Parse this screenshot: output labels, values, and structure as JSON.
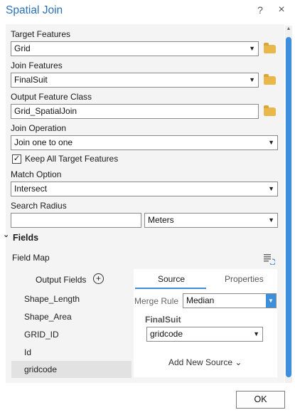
{
  "window": {
    "title": "Spatial Join",
    "help_label": "?",
    "close_label": "×"
  },
  "form": {
    "target_features": {
      "label": "Target Features",
      "value": "Grid"
    },
    "join_features": {
      "label": "Join Features",
      "value": "FinalSuit"
    },
    "output_feature_class": {
      "label": "Output Feature Class",
      "value": "Grid_SpatialJoin"
    },
    "join_operation": {
      "label": "Join Operation",
      "value": "Join one to one"
    },
    "keep_all": {
      "label": "Keep All Target Features",
      "checked": true,
      "check_glyph": "✓"
    },
    "match_option": {
      "label": "Match Option",
      "value": "Intersect"
    },
    "search_radius": {
      "label": "Search Radius",
      "value": "",
      "units": "Meters"
    }
  },
  "fields": {
    "section_label": "Fields",
    "collapse_glyph": "⌄",
    "field_map_label": "Field Map",
    "output_fields_label": "Output Fields",
    "add_glyph": "+",
    "output_fields": [
      "Shape_Length",
      "Shape_Area",
      "GRID_ID",
      "Id",
      "gridcode"
    ],
    "selected_field": "gridcode",
    "tabs": {
      "source": "Source",
      "properties": "Properties",
      "active": "Source"
    },
    "merge_rule_label": "Merge Rule",
    "merge_rule_value": "Median",
    "source_name": "FinalSuit",
    "source_field": "gridcode",
    "add_new_source_label": "Add New Source",
    "add_new_source_glyph": "⌄"
  },
  "buttons": {
    "ok_label": "OK"
  },
  "icons": {
    "folder": "folder-icon",
    "dropdown": "chevron-down-icon",
    "field_map_options": "list-icon"
  },
  "colors": {
    "accent": "#3d8fdc",
    "title": "#2a6fb8",
    "folder": "#e8b84a"
  }
}
